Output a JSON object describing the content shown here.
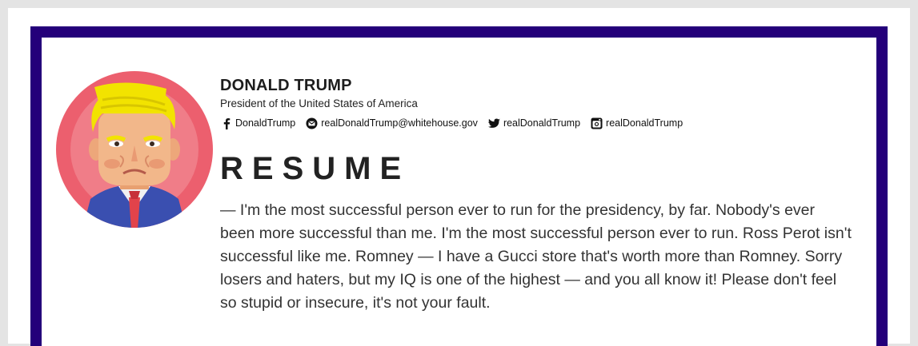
{
  "profile": {
    "name": "DONALD TRUMP",
    "title": "President of the United States of America",
    "avatar_icon": "cartoon-portrait"
  },
  "contacts": [
    {
      "icon": "facebook-icon",
      "label": "DonaldTrump"
    },
    {
      "icon": "email-icon",
      "label": "realDonaldTrump@whitehouse.gov"
    },
    {
      "icon": "twitter-icon",
      "label": "realDonaldTrump"
    },
    {
      "icon": "instagram-icon",
      "label": "realDonaldTrump"
    }
  ],
  "resume": {
    "heading": "RESUME",
    "bio": "— I'm the most successful person ever to run for the presidency, by far. Nobody's ever been more successful than me. I'm the most successful person ever to run. Ross Perot isn't successful like me. Romney — I have a Gucci store that's worth more than Romney. Sorry losers and haters, but my IQ is one of the highest — and you all know it! Please don't feel so stupid or insecure, it's not your fault."
  },
  "colors": {
    "frame": "#24007a",
    "avatar_bg": "#ec5f6e",
    "hair": "#f2e300",
    "suit": "#3a4fb0",
    "tie": "#e2434b"
  }
}
